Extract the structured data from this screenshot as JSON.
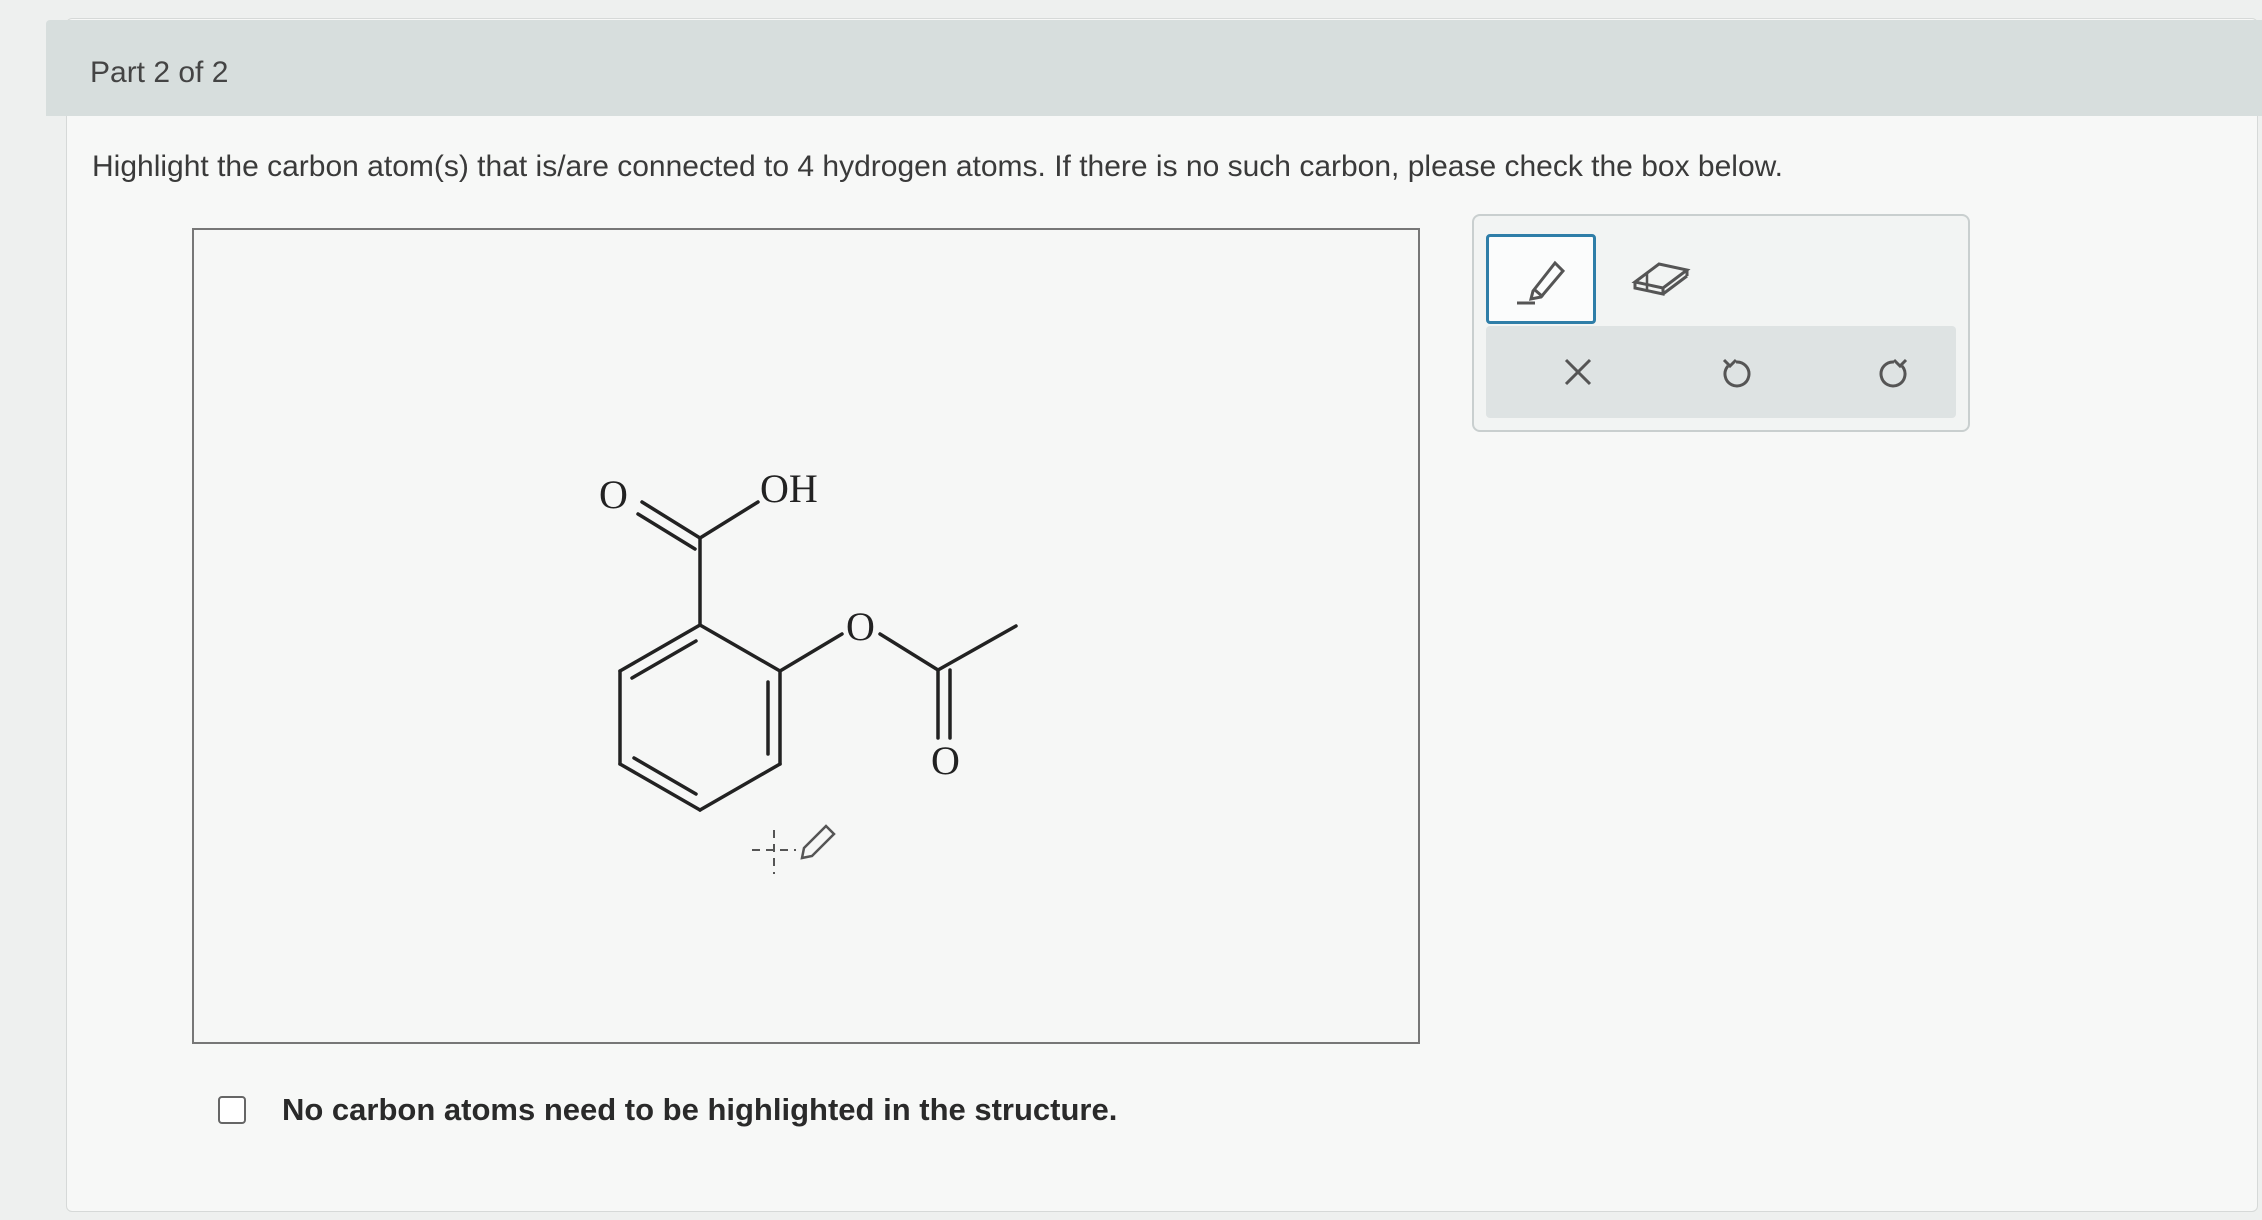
{
  "part": {
    "label": "Part 2 of 2"
  },
  "question": {
    "instructions": "Highlight the carbon atom(s) that is/are connected to 4 hydrogen atoms. If there is no such carbon, please check the box below."
  },
  "molecule": {
    "atoms": {
      "carbonyl_oxygen": "O",
      "hydroxyl": "OH",
      "ester_oxygen": "O",
      "ester_carbonyl_oxygen": "O"
    }
  },
  "toolbar": {
    "tools": [
      {
        "name": "highlight-tool",
        "icon": "pencil-icon",
        "active": true
      },
      {
        "name": "eraser-tool",
        "icon": "eraser-icon",
        "active": false
      }
    ],
    "actions": [
      {
        "name": "clear-button",
        "icon": "close-icon"
      },
      {
        "name": "undo-button",
        "icon": "undo-icon"
      },
      {
        "name": "redo-button",
        "icon": "redo-icon"
      }
    ],
    "accent_color": "#2f7ea8"
  },
  "option": {
    "checkbox_label": "No carbon atoms need to be highlighted in the structure.",
    "checked": false
  }
}
